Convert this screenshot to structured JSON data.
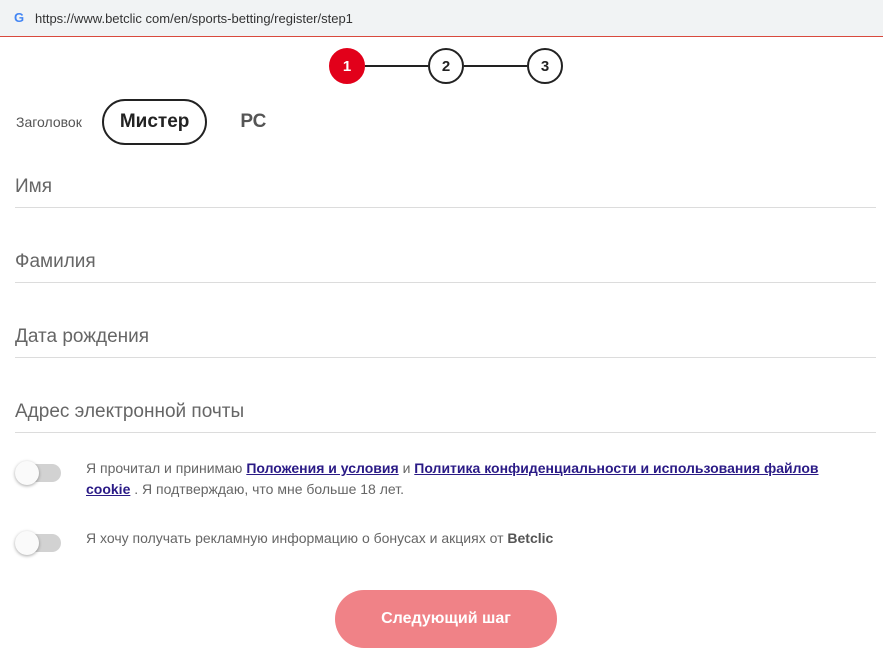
{
  "browser": {
    "url": "https://www.betclic com/en/sports-betting/register/step1",
    "favicon": "google-g-icon"
  },
  "stepper": {
    "steps": [
      "1",
      "2",
      "3"
    ],
    "current": 1
  },
  "title_selector": {
    "label": "Заголовок",
    "options": [
      "Мистер",
      "РС"
    ],
    "selected": "Мистер"
  },
  "form": {
    "first_name_placeholder": "Имя",
    "last_name_placeholder": "Фамилия",
    "birth_date_placeholder": "Дата рождения",
    "email_placeholder": "Адрес электронной почты"
  },
  "consent": {
    "terms": {
      "prefix": "Я прочитал и принимаю",
      "terms_link": "Положения и условия",
      "and": "и",
      "privacy_link": "Политика конфиденциальности и использования файлов cookie",
      "suffix_before_age": ". Я подтверждаю, что мне больше",
      "age": "18",
      "suffix_after_age": "лет.",
      "checked": false
    },
    "marketing": {
      "text": "Я хочу получать рекламную информацию о бонусах и акциях от",
      "brand": "Betclic",
      "checked": false
    }
  },
  "actions": {
    "next_label": "Следующий шаг"
  },
  "colors": {
    "accent": "#e2001a",
    "next_button": "#f08287",
    "link": "#2a1a86"
  }
}
